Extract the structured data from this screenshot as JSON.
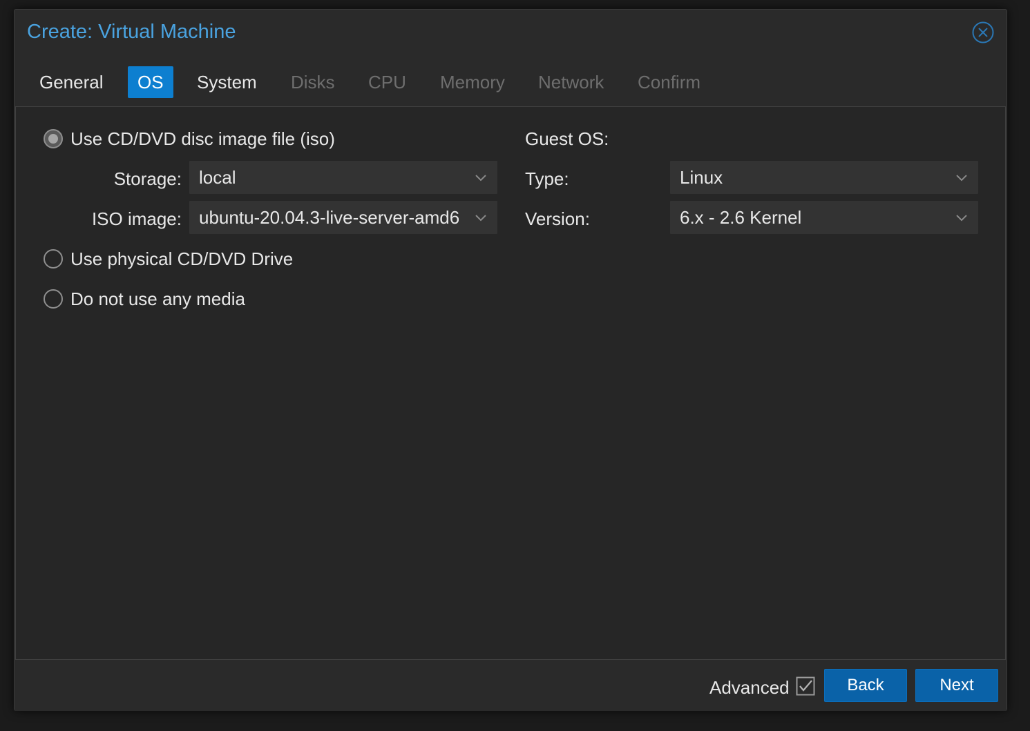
{
  "window": {
    "title": "Create: Virtual Machine",
    "close_icon": "close-circle-icon"
  },
  "tabs": [
    {
      "label": "General",
      "state": "enabled"
    },
    {
      "label": "OS",
      "state": "active"
    },
    {
      "label": "System",
      "state": "enabled"
    },
    {
      "label": "Disks",
      "state": "disabled"
    },
    {
      "label": "CPU",
      "state": "disabled"
    },
    {
      "label": "Memory",
      "state": "disabled"
    },
    {
      "label": "Network",
      "state": "disabled"
    },
    {
      "label": "Confirm",
      "state": "disabled"
    }
  ],
  "media": {
    "options": [
      {
        "label": "Use CD/DVD disc image file (iso)",
        "checked": true
      },
      {
        "label": "Use physical CD/DVD Drive",
        "checked": false
      },
      {
        "label": "Do not use any media",
        "checked": false
      }
    ],
    "storage": {
      "label": "Storage:",
      "value": "local"
    },
    "iso_image": {
      "label": "ISO image:",
      "value": "ubuntu-20.04.3-live-server-amd6"
    }
  },
  "guest_os": {
    "heading": "Guest OS:",
    "type": {
      "label": "Type:",
      "value": "Linux"
    },
    "version": {
      "label": "Version:",
      "value": "6.x - 2.6 Kernel"
    }
  },
  "footer": {
    "advanced_label": "Advanced",
    "advanced_checked": true,
    "back_label": "Back",
    "next_label": "Next"
  },
  "colors": {
    "accent": "#0d7fd0",
    "title": "#4aa3e0",
    "button": "#0a62a8",
    "background": "#262626"
  }
}
